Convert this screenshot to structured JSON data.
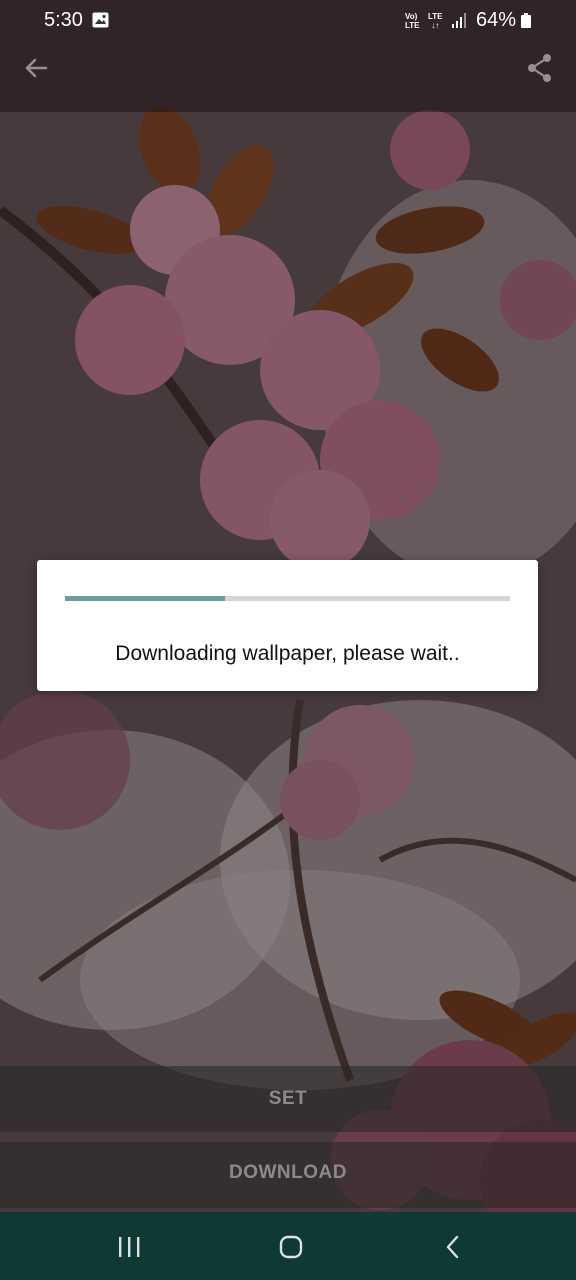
{
  "status_bar": {
    "time": "5:30",
    "network_top": "Vo)",
    "network_bottom": "LTE",
    "lte_top": "LTE",
    "lte_bottom": "↓↑",
    "battery": "64%"
  },
  "app_bar": {
    "back_icon": "arrow-back-icon",
    "share_icon": "share-icon"
  },
  "dialog": {
    "message": "Downloading wallpaper, please wait..",
    "progress_fraction": 0.36,
    "accent_color": "#6b9e99"
  },
  "actions": {
    "set_label": "SET",
    "download_label": "DOWNLOAD"
  },
  "nav_bar": {
    "background": "#0e3a33",
    "icons": [
      "recents-icon",
      "home-icon",
      "back-icon"
    ]
  }
}
